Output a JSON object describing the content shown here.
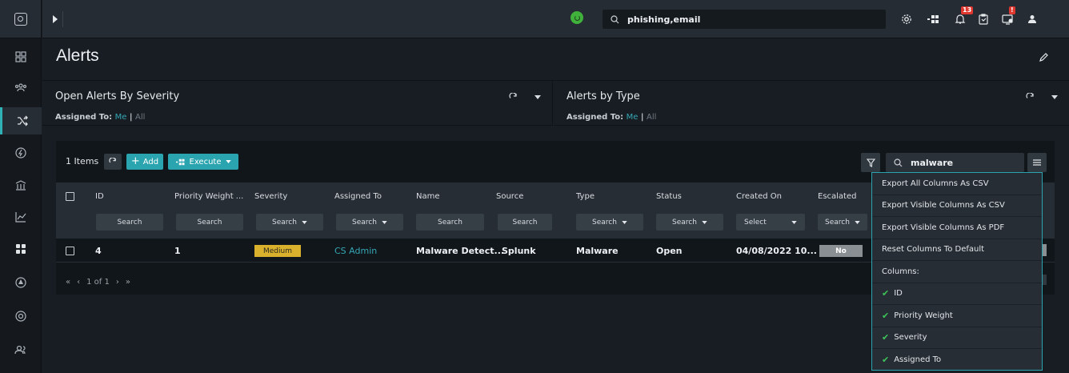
{
  "topbar": {
    "search_value": "phishing,email",
    "notification_count": "13",
    "alert_badge": "!"
  },
  "page": {
    "title": "Alerts"
  },
  "widgets": [
    {
      "title": "Open Alerts By Severity",
      "assigned_label": "Assigned To:",
      "me": "Me",
      "sep": "|",
      "all": "All"
    },
    {
      "title": "Alerts by Type",
      "assigned_label": "Assigned To:",
      "me": "Me",
      "sep": "|",
      "all": "All"
    }
  ],
  "grid": {
    "items_count": "1 Items",
    "add_label": "Add",
    "execute_label": "Execute",
    "search_value": "malware",
    "columns": [
      "ID",
      "Priority Weight ...",
      "Severity",
      "Assigned To",
      "Name",
      "Source",
      "Type",
      "Status",
      "Created On",
      "Escalated"
    ],
    "filters": [
      "Search",
      "Search",
      "Search",
      "Search",
      "Search",
      "Search",
      "Search",
      "Search",
      "Select",
      "Search"
    ],
    "row": {
      "id": "4",
      "priority_weight": "1",
      "severity": "Medium",
      "assigned_to": "CS Admin",
      "name": "Malware Detect...",
      "source": "Splunk",
      "type": "Malware",
      "status": "Open",
      "created_on": "04/08/2022 10...",
      "escalated": "No"
    },
    "pager": "1 of 1"
  },
  "dropdown": {
    "items": [
      "Export All Columns As CSV",
      "Export Visible Columns As CSV",
      "Export Visible Columns As PDF",
      "Reset Columns To Default",
      "Columns:"
    ],
    "columns": [
      "ID",
      "Priority Weight",
      "Severity",
      "Assigned To"
    ]
  },
  "colors": {
    "accent": "#2aa4ae",
    "severity_medium": "#d9b12c",
    "notification": "#e0382f",
    "online": "#40b23c"
  }
}
